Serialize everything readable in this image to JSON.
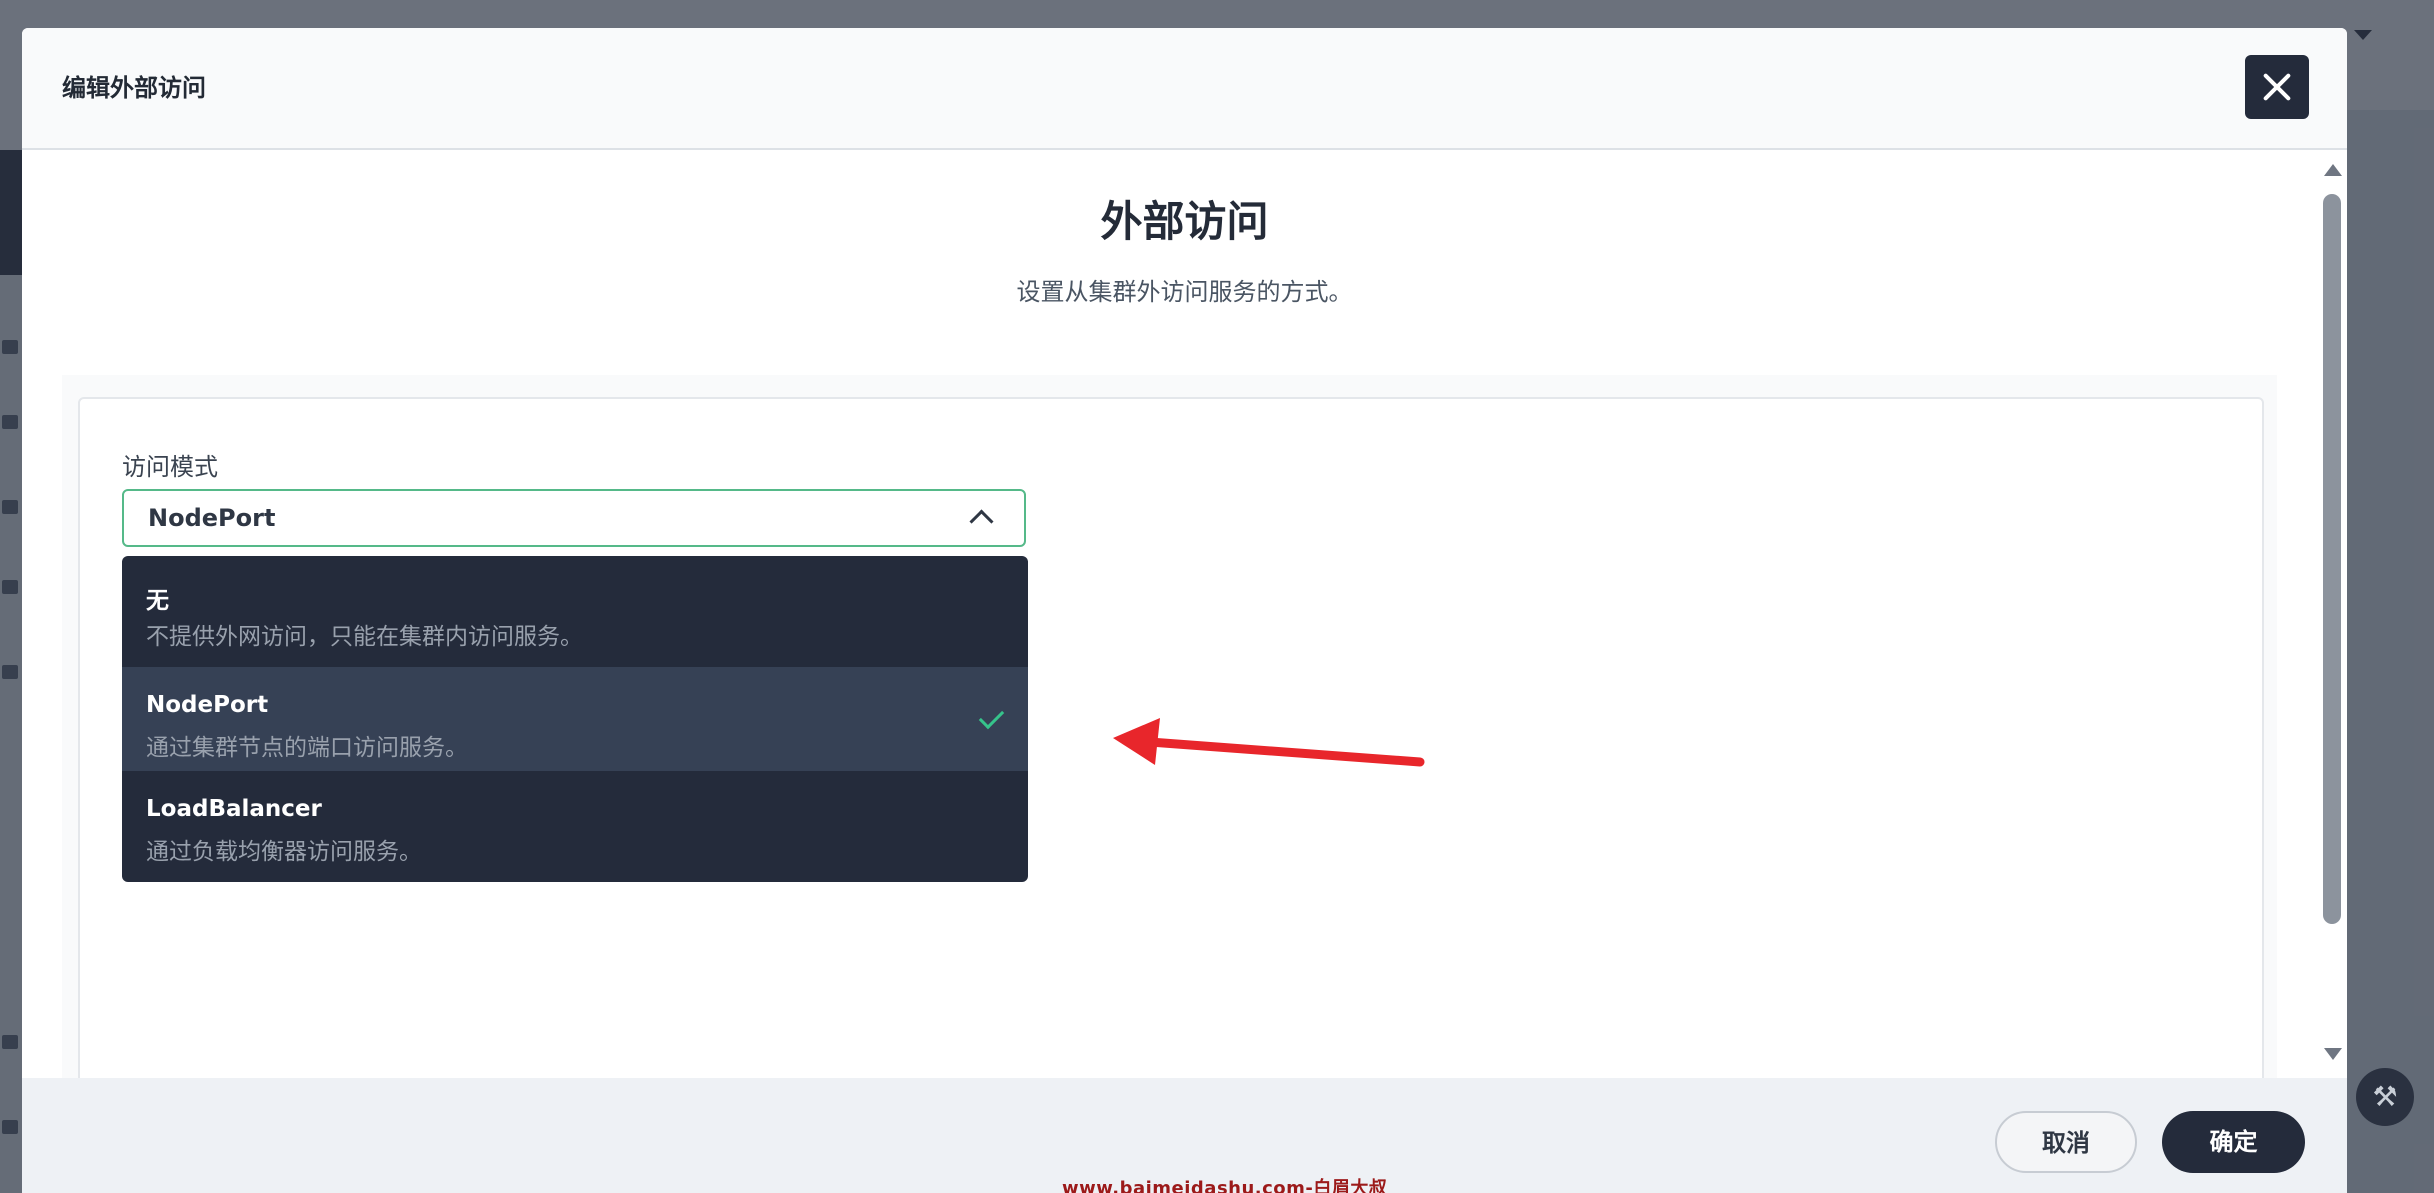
{
  "modal": {
    "title": "编辑外部访问",
    "close_icon": "close-icon"
  },
  "section": {
    "title": "外部访问",
    "subtitle": "设置从集群外访问服务的方式。"
  },
  "access_mode": {
    "label": "访问模式",
    "selected": "NodePort",
    "options": [
      {
        "label": "无",
        "description": "不提供外网访问，只能在集群内访问服务。",
        "selected": false
      },
      {
        "label": "NodePort",
        "description": "通过集群节点的端口访问服务。",
        "selected": true
      },
      {
        "label": "LoadBalancer",
        "description": "通过负载均衡器访问服务。",
        "selected": false
      }
    ]
  },
  "footer": {
    "watermark": "www.baimeidashu.com-白眉大叔",
    "cancel_label": "取消",
    "confirm_label": "确定"
  },
  "colors": {
    "accent": "#55b989",
    "check": "#36c38b",
    "dropdown_bg": "#242b3b",
    "dropdown_selected_bg": "#364155",
    "annotation_arrow": "#e8262b"
  }
}
